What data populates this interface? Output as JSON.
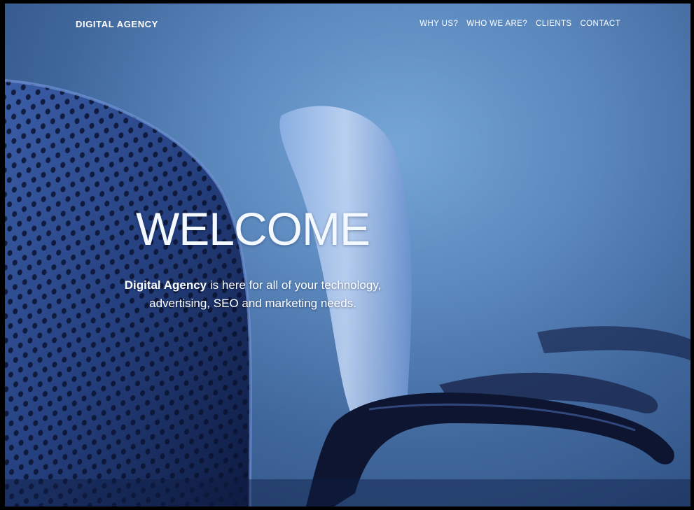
{
  "nav": {
    "brand": "DIGITAL AGENCY",
    "links": [
      "WHY US?",
      "WHO WE ARE?",
      "CLIENTS",
      "CONTACT"
    ]
  },
  "hero": {
    "title": "WELCOME",
    "subtitle_strong": "Digital Agency",
    "subtitle_line1_rest": " is here for all of your technology,",
    "subtitle_line2": "advertising, SEO and marketing needs.",
    "image": "office-chairs-photo"
  },
  "colors": {
    "background_blue": "#5b88bd",
    "text": "#ffffff"
  }
}
